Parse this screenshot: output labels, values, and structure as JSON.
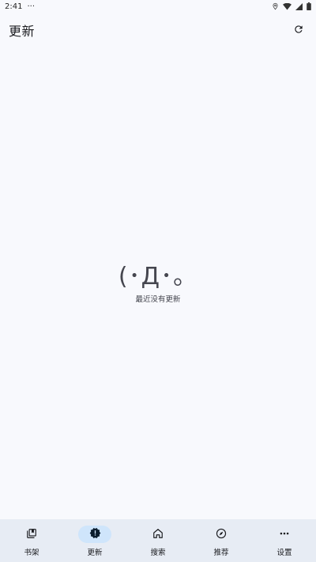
{
  "status_bar": {
    "time": "2:41",
    "extra": "···"
  },
  "header": {
    "title": "更新",
    "refresh_icon": "refresh-icon"
  },
  "empty_state": {
    "kaomoji": "(･Д･。",
    "message": "最近没有更新"
  },
  "bottom_nav": {
    "active_index": 1,
    "items": [
      {
        "label": "书架",
        "icon": "library-icon"
      },
      {
        "label": "更新",
        "icon": "new-releases-icon"
      },
      {
        "label": "搜索",
        "icon": "home-icon"
      },
      {
        "label": "推荐",
        "icon": "explore-icon"
      },
      {
        "label": "设置",
        "icon": "more-icon"
      }
    ]
  },
  "colors": {
    "background": "#f8f9fd",
    "nav_background": "#e7ecf4",
    "active_pill": "#cfe5fb",
    "text": "#1b1c20"
  }
}
